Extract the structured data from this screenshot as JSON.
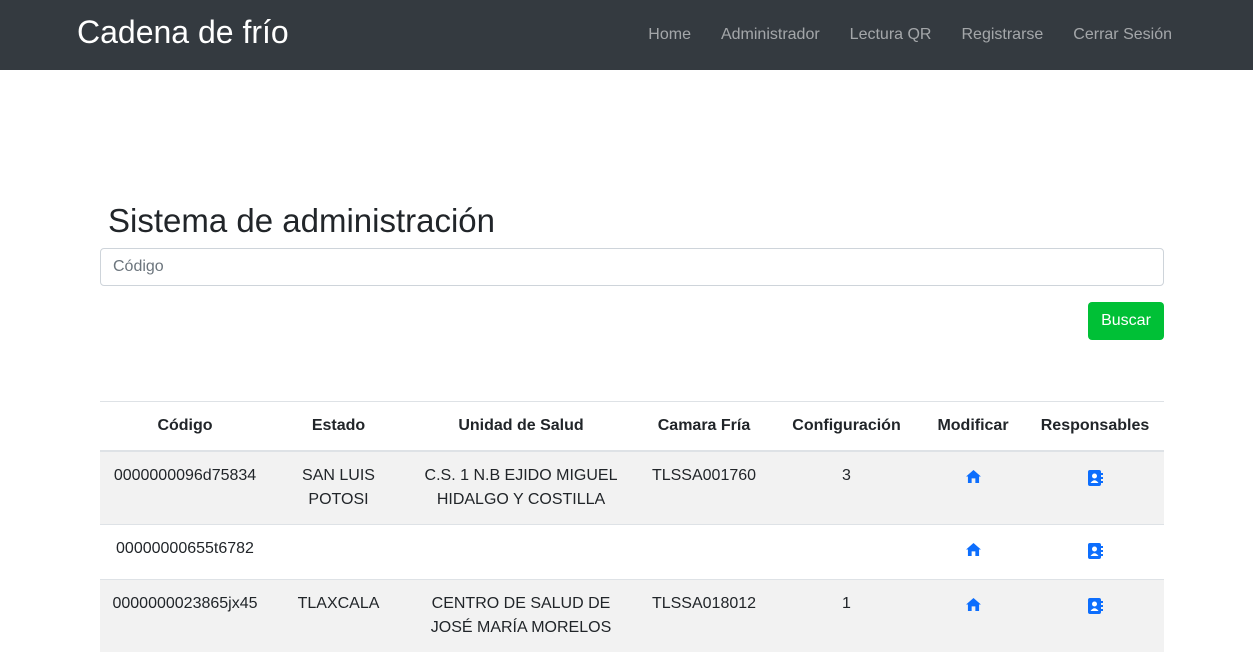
{
  "navbar": {
    "brand": "Cadena de frío",
    "links": [
      "Home",
      "Administrador",
      "Lectura QR",
      "Registrarse",
      "Cerrar Sesión"
    ]
  },
  "main": {
    "title": "Sistema de administración",
    "search": {
      "placeholder": "Código",
      "value": ""
    },
    "search_button": "Buscar"
  },
  "table": {
    "headers": [
      "Código",
      "Estado",
      "Unidad de Salud",
      "Camara Fría",
      "Configuración",
      "Modificar",
      "Responsables"
    ],
    "rows": [
      {
        "codigo": "0000000096d75834",
        "estado": "SAN LUIS POTOSI",
        "unidad": "C.S. 1 N.B EJIDO MIGUEL HIDALGO Y COSTILLA",
        "camara": "TLSSA001760",
        "config": "3"
      },
      {
        "codigo": "00000000655t6782",
        "estado": "",
        "unidad": "",
        "camara": "",
        "config": ""
      },
      {
        "codigo": "0000000023865jx45",
        "estado": "TLAXCALA",
        "unidad": "CENTRO DE SALUD DE JOSÉ MARÍA MORELOS",
        "camara": "TLSSA018012",
        "config": "1"
      }
    ],
    "icons": {
      "modificar": "home-icon",
      "responsables": "address-book-icon"
    }
  },
  "colors": {
    "navbar_bg": "#343a40",
    "button_green": "#00c036",
    "icon_blue": "#0d6efd",
    "stripe": "#f2f2f2"
  }
}
